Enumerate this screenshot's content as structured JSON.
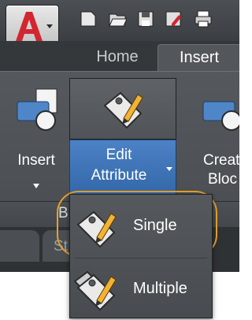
{
  "ribbon_tabs": {
    "home": "Home",
    "insert": "Insert"
  },
  "ribbon": {
    "insert_button": "Insert",
    "edit_attribute_line1": "Edit",
    "edit_attribute_line2": "Attribute",
    "create_block_line1": "Creat",
    "create_block_line2": "Bloc",
    "panel_title_fragment": "B"
  },
  "lower_tab_fragment": "St",
  "menu": {
    "single": "Single",
    "multiple": "Multiple"
  },
  "colors": {
    "accent_blue": "#3f76ba",
    "highlight_ring": "#e7a02e",
    "app_logo_red": "#d22630"
  },
  "icons": {
    "app_button": "autocad-logo-icon",
    "qat": [
      "new-icon",
      "open-icon",
      "save-icon",
      "save-as-icon",
      "print-icon"
    ],
    "insert": "insert-block-icon",
    "edit_attribute": "tag-pencil-icon",
    "create_block": "create-block-icon"
  }
}
